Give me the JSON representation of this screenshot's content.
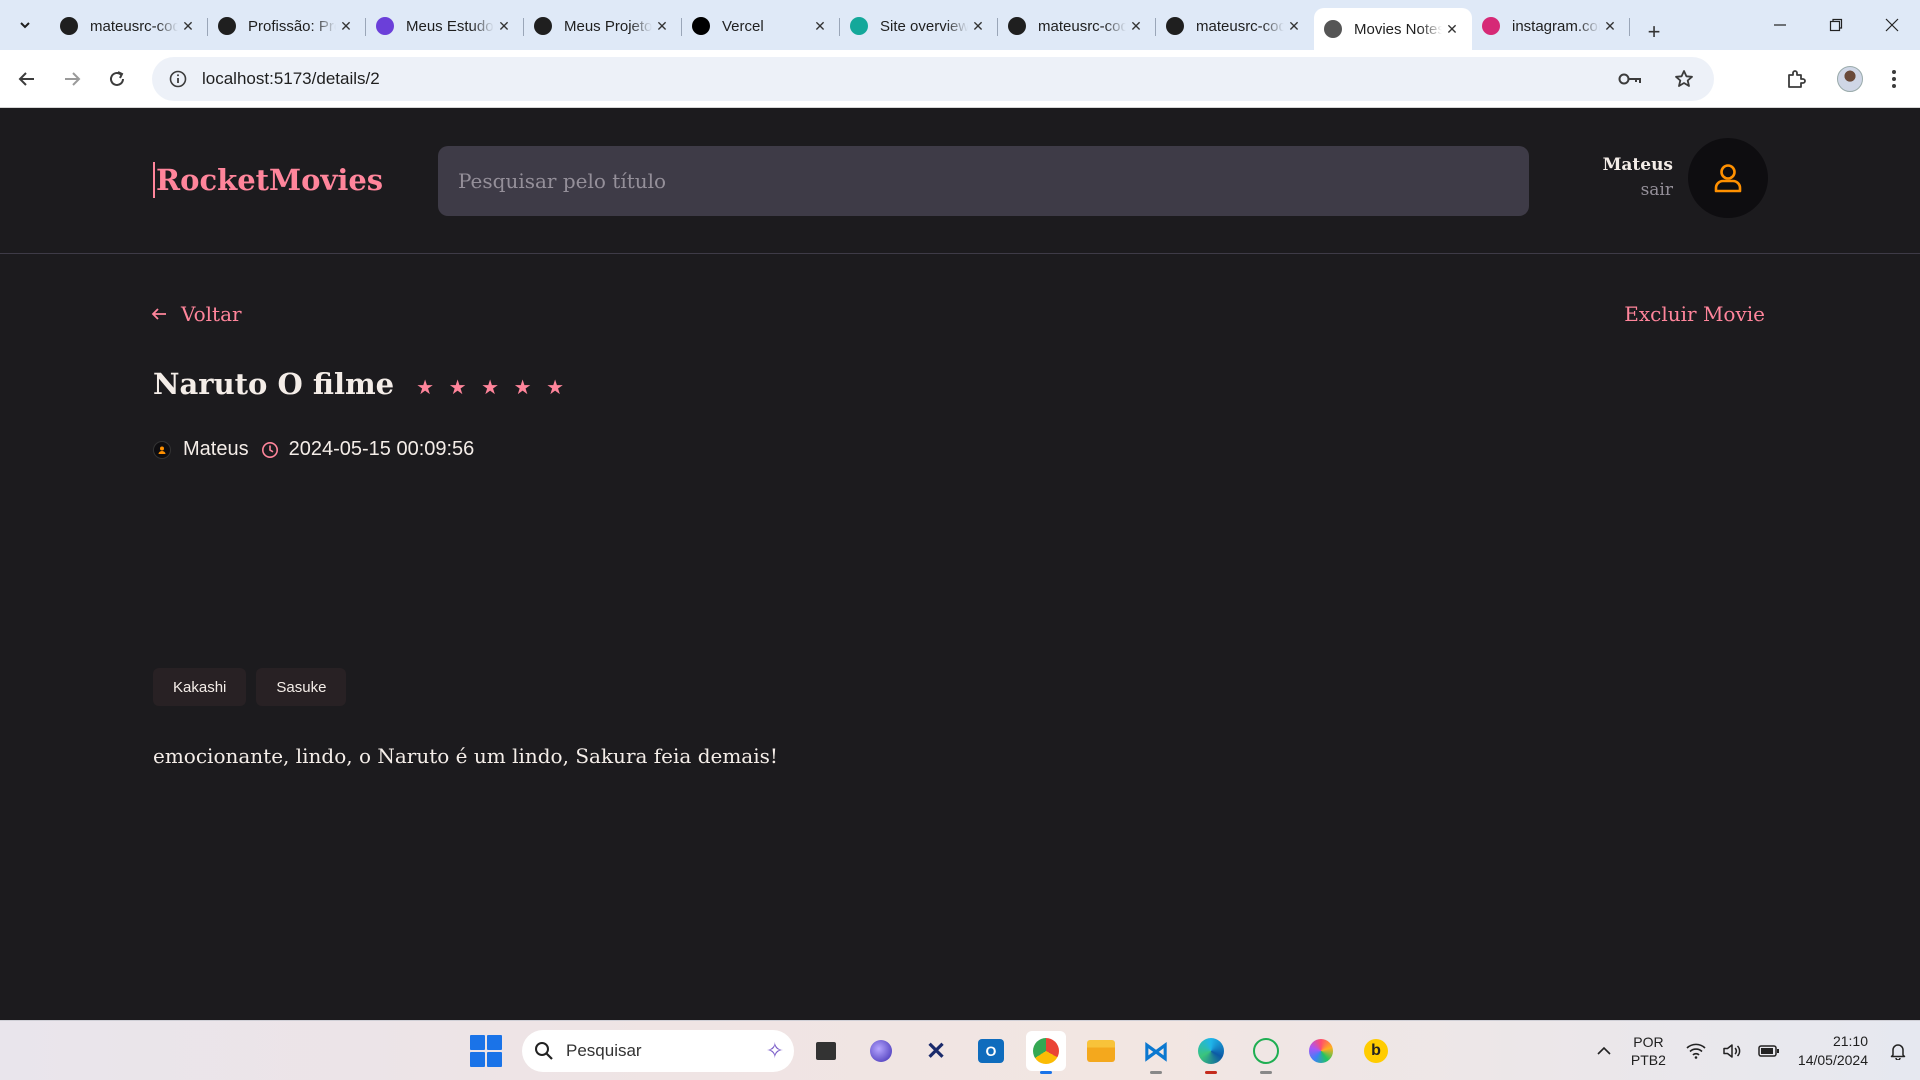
{
  "browser": {
    "tabs": [
      {
        "title": "mateusrc-code",
        "icon": "github-icon",
        "color": "#1f1f1f"
      },
      {
        "title": "Profissão: Programador",
        "icon": "profissao-icon",
        "color": "#1f1f1f"
      },
      {
        "title": "Meus Estudos",
        "icon": "rocket-icon",
        "color": "#6b3fd9"
      },
      {
        "title": "Meus Projetos",
        "icon": "react-icon",
        "color": "#1f1f1f"
      },
      {
        "title": "Vercel",
        "icon": "vercel-icon",
        "color": "#000000"
      },
      {
        "title": "Site overview",
        "icon": "netlify-icon",
        "color": "#14a89a"
      },
      {
        "title": "mateusrc-code",
        "icon": "github-icon",
        "color": "#1f1f1f"
      },
      {
        "title": "mateusrc-code",
        "icon": "github-icon",
        "color": "#1f1f1f"
      },
      {
        "title": "Movies Notes",
        "icon": "globe-icon",
        "color": "#555555",
        "active": true
      },
      {
        "title": "instagram.com",
        "icon": "instagram-icon",
        "color": "#d62976"
      }
    ],
    "url": "localhost:5173/details/2"
  },
  "header": {
    "brand": "RocketMovies",
    "search_placeholder": "Pesquisar pelo título",
    "user_name": "Mateus",
    "logout_label": "sair"
  },
  "details": {
    "back_label": "Voltar",
    "delete_label": "Excluir Movie",
    "title": "Naruto O filme",
    "rating": 5,
    "author": "Mateus",
    "created_at": "2024-05-15 00:09:56",
    "tags": [
      "Kakashi",
      "Sasuke"
    ],
    "description": "emocionante, lindo, o Naruto é um lindo, Sakura feia demais!"
  },
  "taskbar": {
    "search_label": "Pesquisar",
    "lang_line1": "POR",
    "lang_line2": "PTB2",
    "time": "21:10",
    "date": "14/05/2024"
  },
  "colors": {
    "accent": "#ff859b",
    "background": "#1c1b1e",
    "input_bg": "#3e3b47",
    "tag_bg": "#282124",
    "avatar_icon": "#ff9000"
  }
}
